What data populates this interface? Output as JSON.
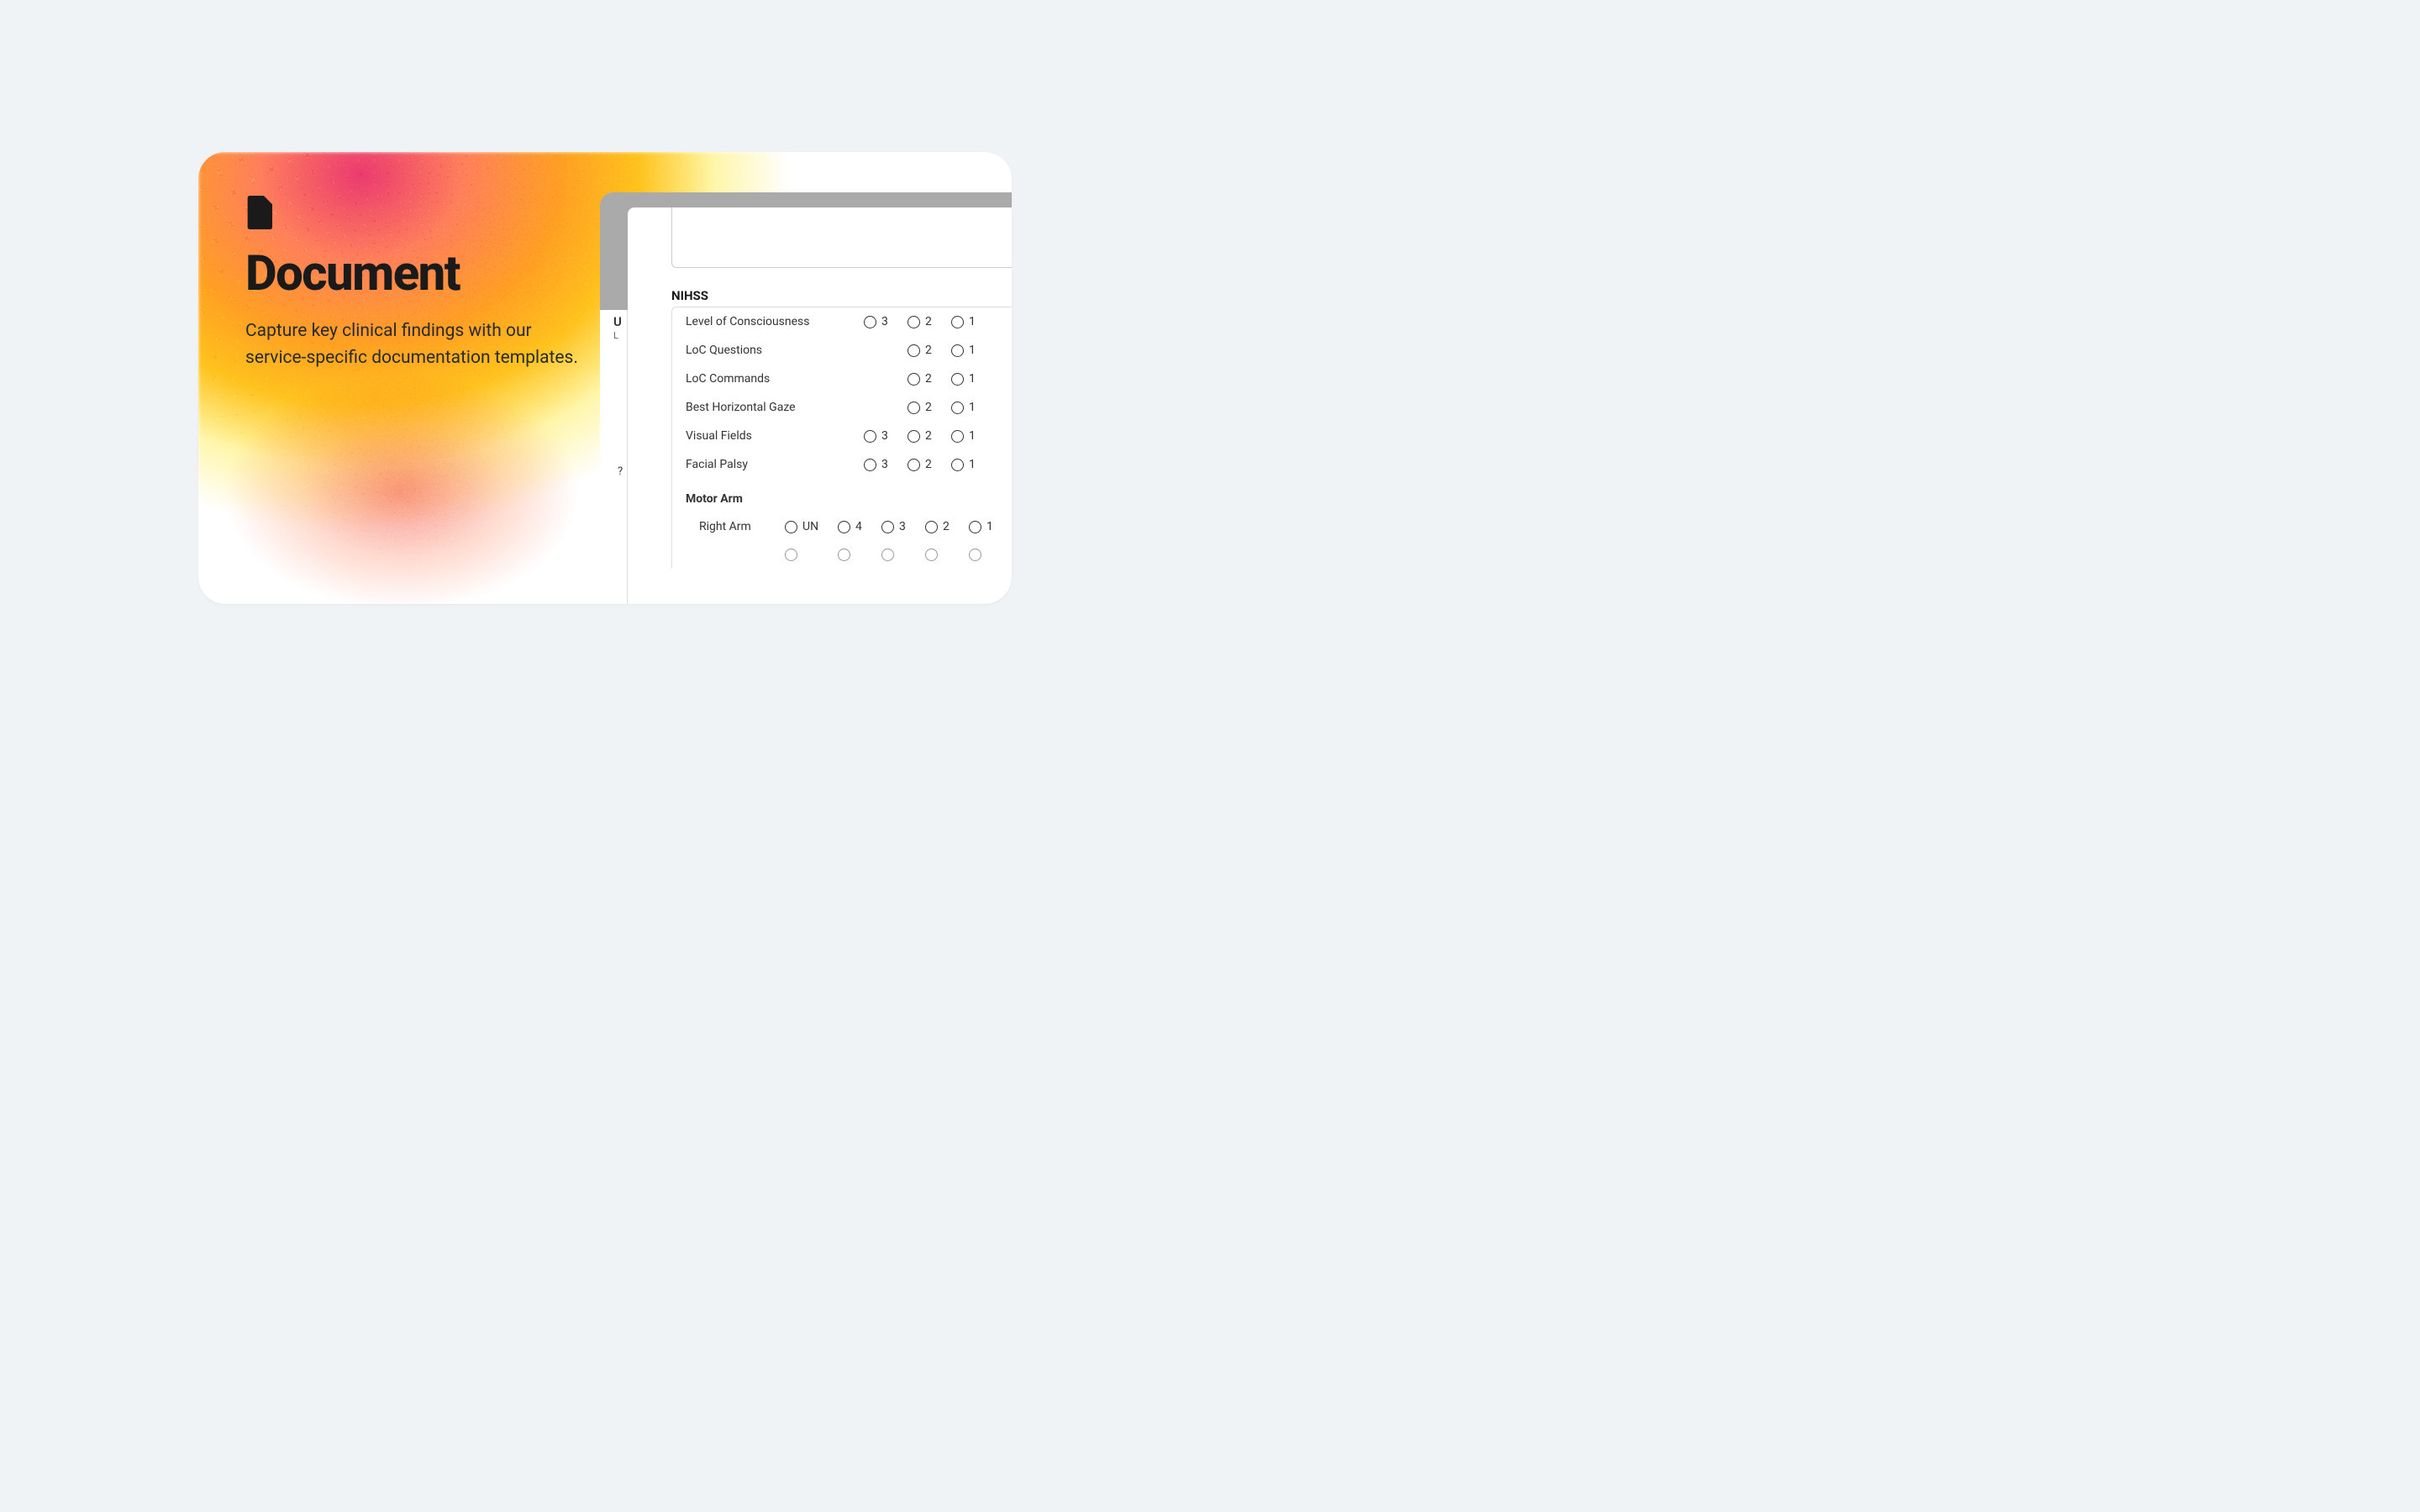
{
  "card": {
    "title": "Document",
    "description": "Capture key clinical findings with our service-specific documentation templates.",
    "icon": "document-icon"
  },
  "sidebar": {
    "letter1": "U",
    "letter2": "L",
    "question": "?"
  },
  "form": {
    "section_title": "NIHSS",
    "rows": [
      {
        "label": "Level of Consciousness",
        "options": [
          "3",
          "2",
          "1"
        ]
      },
      {
        "label": "LoC Questions",
        "options": [
          "2",
          "1"
        ]
      },
      {
        "label": "LoC Commands",
        "options": [
          "2",
          "1"
        ]
      },
      {
        "label": "Best Horizontal Gaze",
        "options": [
          "2",
          "1"
        ]
      },
      {
        "label": "Visual Fields",
        "options": [
          "3",
          "2",
          "1"
        ]
      },
      {
        "label": "Facial Palsy",
        "options": [
          "3",
          "2",
          "1"
        ]
      }
    ],
    "subsection": {
      "title": "Motor Arm",
      "rows": [
        {
          "label": "Right Arm",
          "options": [
            "UN",
            "4",
            "3",
            "2",
            "1"
          ]
        }
      ]
    }
  }
}
